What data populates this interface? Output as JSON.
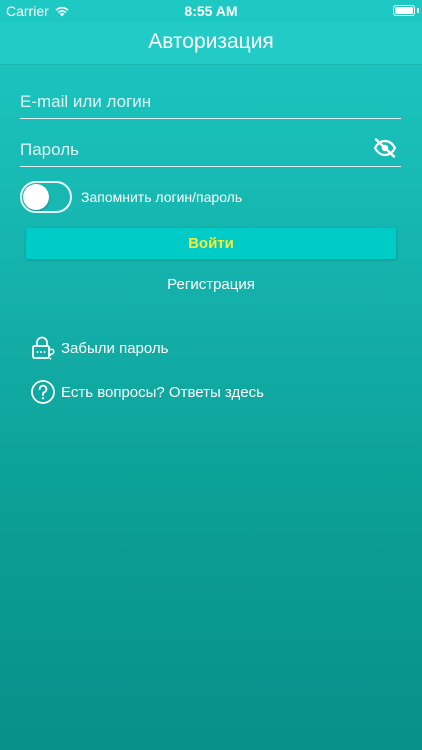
{
  "status_bar": {
    "carrier": "Carrier",
    "time": "8:55 AM"
  },
  "nav": {
    "title": "Авторизация"
  },
  "form": {
    "login_placeholder": "E-mail или логин",
    "password_placeholder": "Пароль",
    "remember_label": "Запомнить логин/пароль",
    "remember_on": false,
    "login_button": "Войти",
    "register_link": "Регистрация"
  },
  "links": {
    "forgot_password": "Забыли пароль",
    "faq": "Есть вопросы? Ответы здесь"
  },
  "icons": {
    "wifi": "wifi-icon",
    "battery": "battery-icon",
    "eye_off": "eye-off-icon",
    "lock": "lock-question-icon",
    "help": "question-circle-icon"
  },
  "colors": {
    "gradient_top": "#1ec9c4",
    "gradient_bottom": "#079088",
    "nav_bar": "#22cbc6",
    "button_bg": "#00ccc7",
    "button_text": "#f3ee3c"
  }
}
